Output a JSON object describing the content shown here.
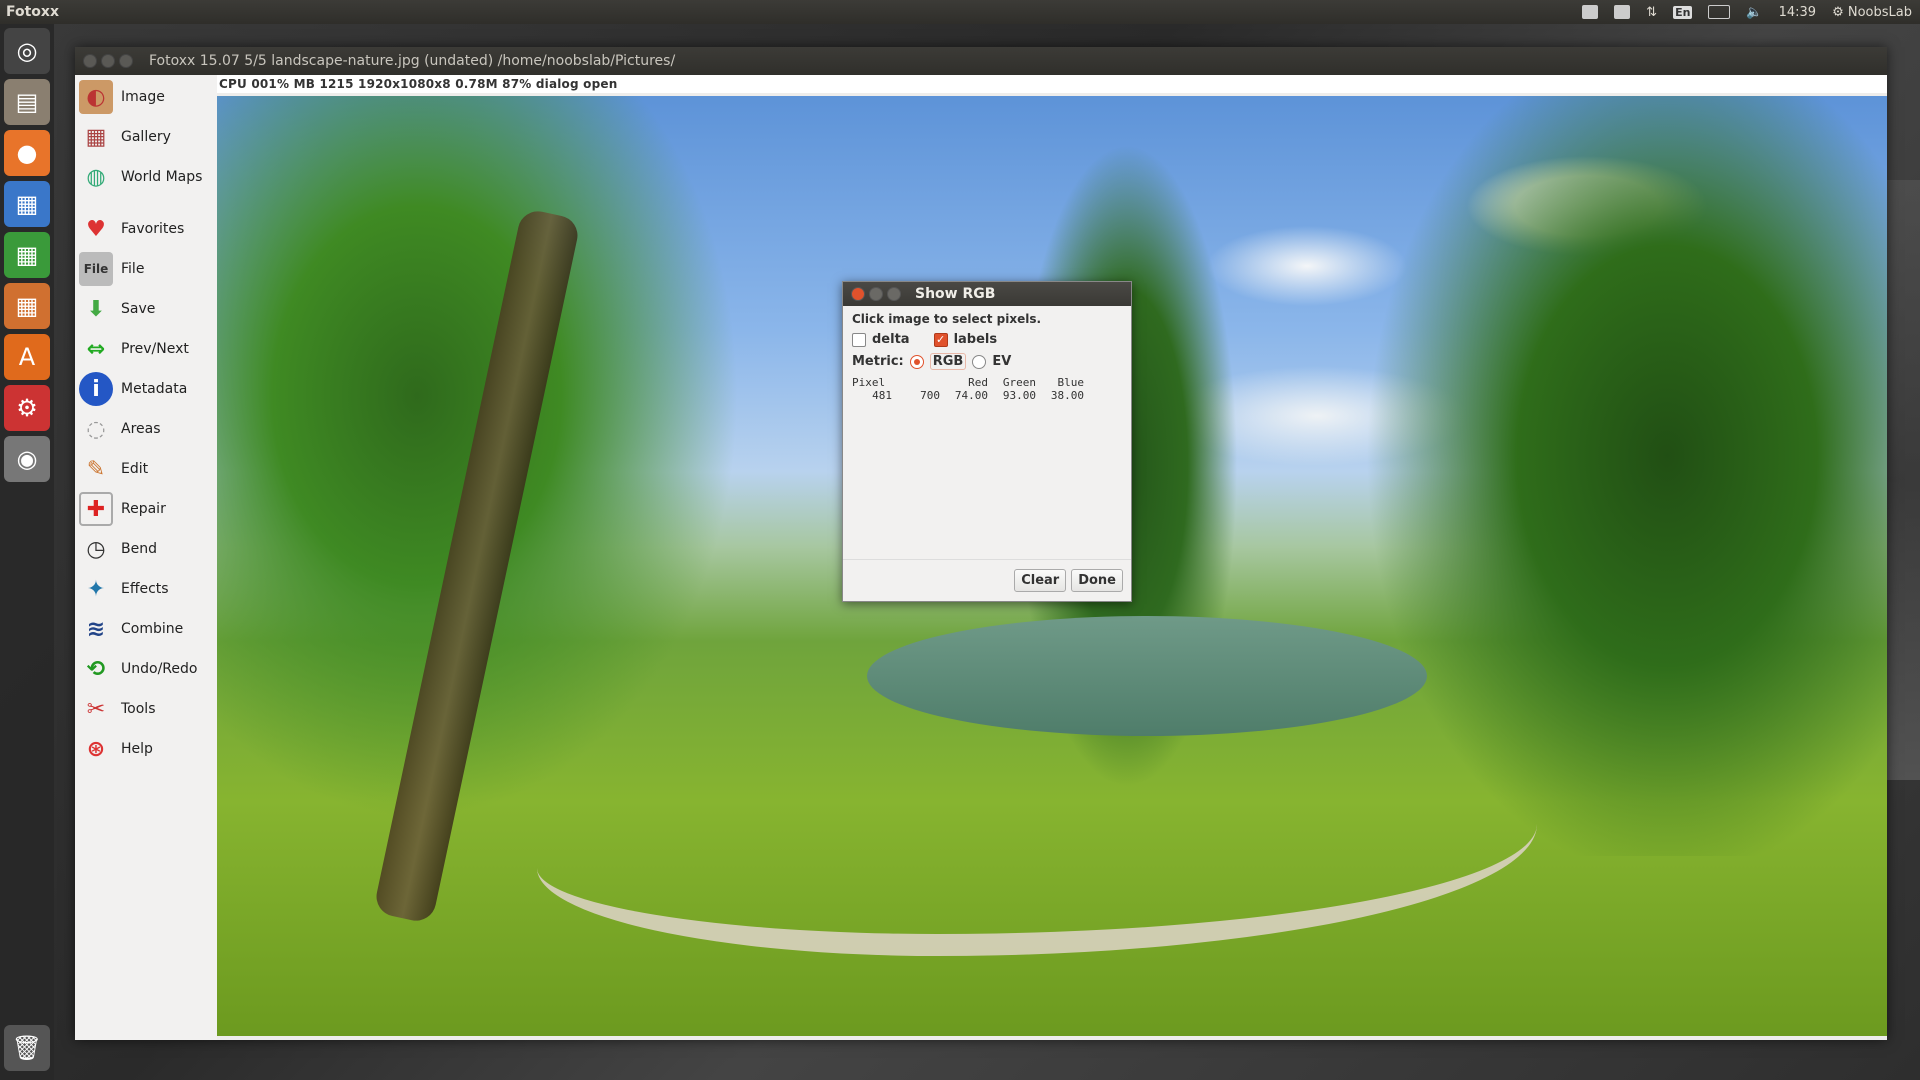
{
  "top_panel": {
    "app_name": "Fotoxx",
    "keyboard": "En",
    "time": "14:39",
    "user": "NoobsLab"
  },
  "window": {
    "title": "Fotoxx 15.07  5/5  landscape-nature.jpg  (undated)  /home/noobslab/Pictures/",
    "status": "CPU 001%  MB 1215  1920x1080x8  0.78M  87%  dialog open"
  },
  "menu": [
    {
      "label": "Image",
      "icon": "image-icon",
      "color": "#b33"
    },
    {
      "label": "Gallery",
      "icon": "gallery-icon",
      "color": "#a44"
    },
    {
      "label": "World Maps",
      "icon": "globe-icon",
      "color": "#3a7"
    },
    {
      "label": "Favorites",
      "icon": "heart-icon",
      "color": "#d33"
    },
    {
      "label": "File",
      "icon": "file-icon",
      "color": "#666"
    },
    {
      "label": "Save",
      "icon": "save-icon",
      "color": "#4a4"
    },
    {
      "label": "Prev/Next",
      "icon": "arrows-icon",
      "color": "#2a2"
    },
    {
      "label": "Metadata",
      "icon": "info-icon",
      "color": "#2457c5"
    },
    {
      "label": "Areas",
      "icon": "areas-icon",
      "color": "#888"
    },
    {
      "label": "Edit",
      "icon": "edit-icon",
      "color": "#c73"
    },
    {
      "label": "Repair",
      "icon": "repair-icon",
      "color": "#d22"
    },
    {
      "label": "Bend",
      "icon": "bend-icon",
      "color": "#333"
    },
    {
      "label": "Effects",
      "icon": "effects-icon",
      "color": "#27a"
    },
    {
      "label": "Combine",
      "icon": "combine-icon",
      "color": "#248"
    },
    {
      "label": "Undo/Redo",
      "icon": "undo-redo-icon",
      "color": "#292"
    },
    {
      "label": "Tools",
      "icon": "tools-icon",
      "color": "#c33"
    },
    {
      "label": "Help",
      "icon": "help-icon",
      "color": "#d33"
    }
  ],
  "dialog": {
    "title": "Show RGB",
    "instruction": "Click image to select pixels.",
    "delta_label": "delta",
    "labels_label": "labels",
    "metric_label": "Metric:",
    "rgb_label": "RGB",
    "ev_label": "EV",
    "headers": [
      "Pixel",
      "",
      "Red",
      "Green",
      "Blue"
    ],
    "values": [
      "481",
      "700",
      "74.00",
      "93.00",
      "38.00"
    ],
    "clear_label": "Clear",
    "done_label": "Done"
  }
}
